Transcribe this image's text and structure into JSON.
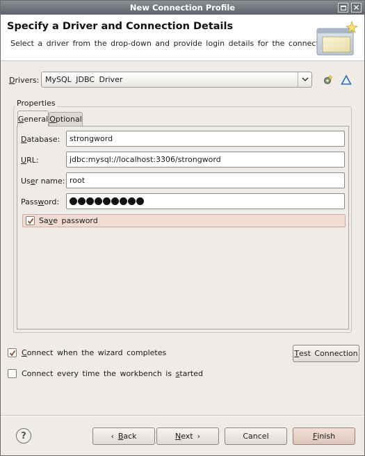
{
  "window": {
    "title": "New Connection Profile"
  },
  "banner": {
    "title": "Specify a Driver and Connection Details",
    "description": "Select a driver from the drop-down and provide login details for the connection."
  },
  "drivers": {
    "label_mnemonic": "D",
    "label_rest": "rivers:",
    "selected": "MySQL JDBC Driver"
  },
  "properties": {
    "group_label": "Properties",
    "tabs": [
      {
        "mnemonic": "G",
        "rest": "eneral",
        "active": true
      },
      {
        "mnemonic": "O",
        "rest": "ptional",
        "active": false
      }
    ],
    "fields": {
      "database": {
        "label_mnemonic": "D",
        "label_rest": "atabase:",
        "value": "strongword"
      },
      "url": {
        "label_mnemonic": "U",
        "label_rest": "RL:",
        "value": "jdbc:mysql://localhost:3306/strongword"
      },
      "username": {
        "label_pre": "Us",
        "label_mnemonic": "e",
        "label_rest": "r name:",
        "value": "root"
      },
      "password": {
        "label_pre": "Pass",
        "label_mnemonic": "w",
        "label_rest": "ord:",
        "dot_count": 9
      }
    },
    "save_password": {
      "label_pre": "Sa",
      "label_mnemonic": "v",
      "label_rest": "e password",
      "checked": true
    }
  },
  "options": {
    "connect_on_complete": {
      "label_mnemonic": "C",
      "label_rest": "onnect when the wizard completes",
      "checked": true
    },
    "connect_every_start": {
      "label_pre": "Connect every time the workbench is ",
      "label_mnemonic": "s",
      "label_rest": "tarted",
      "checked": false
    }
  },
  "buttons": {
    "test_connection": {
      "mnemonic": "T",
      "rest": "est Connection"
    },
    "back": {
      "mnemonic": "B",
      "rest": "ack"
    },
    "next": {
      "mnemonic": "N",
      "rest": "ext"
    },
    "cancel": "Cancel",
    "finish": {
      "mnemonic": "F",
      "rest": "inish"
    },
    "help": "?"
  },
  "colors": {
    "accent_highlight": "#f1dcd4",
    "titlebar": "#6a6f75",
    "window_bg": "#efebe7"
  }
}
